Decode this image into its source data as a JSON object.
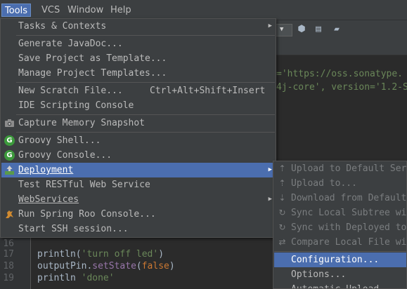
{
  "menubar": {
    "items": [
      {
        "label": "Tools"
      },
      {
        "label": "VCS"
      },
      {
        "label": "Window"
      },
      {
        "label": "Help"
      }
    ]
  },
  "editor": {
    "top_lines": [
      {
        "text_a": "='https://oss.sonatype."
      },
      {
        "text_a": "4j-core', version='1.2-S"
      }
    ],
    "lines": [
      {
        "num": "16",
        "code": ""
      },
      {
        "num": "17",
        "fn": "println",
        "open": "(",
        "str": "'turn off led'",
        "close": ")"
      },
      {
        "num": "18",
        "obj": "outputPin.",
        "fn": "setState",
        "open": "(",
        "kw": "false",
        "close": ")"
      },
      {
        "num": "19",
        "fn": "println",
        "space": " ",
        "str": "'done'"
      }
    ]
  },
  "tools_menu": {
    "items": [
      {
        "label": "Tasks & Contexts",
        "has_submenu": true
      },
      {
        "label": "Generate JavaDoc..."
      },
      {
        "label": "Save Project as Template..."
      },
      {
        "label": "Manage Project Templates..."
      },
      {
        "label": "New Scratch File...",
        "shortcut": "Ctrl+Alt+Shift+Insert"
      },
      {
        "label": "IDE Scripting Console"
      },
      {
        "label": "Capture Memory Snapshot",
        "icon": "memory-snapshot-icon"
      },
      {
        "label": "Groovy Shell...",
        "icon": "groovy-icon",
        "icon_text": "G"
      },
      {
        "label": "Groovy Console...",
        "icon": "groovy-icon",
        "icon_text": "G"
      },
      {
        "label": "Deployment",
        "icon": "deployment-icon",
        "has_submenu": true,
        "selected": true
      },
      {
        "label": "Test RESTful Web Service"
      },
      {
        "label": "WebServices",
        "has_submenu": true
      },
      {
        "label": "Run Spring Roo Console...",
        "icon": "spring-roo-icon"
      },
      {
        "label": "Start SSH session..."
      }
    ]
  },
  "deployment_menu": {
    "items": [
      {
        "label": "Upload to Default Ser",
        "icon": "upload-icon",
        "disabled": true
      },
      {
        "label": "Upload to...",
        "icon": "upload-icon",
        "disabled": true
      },
      {
        "label": "Download from Default",
        "icon": "download-icon",
        "disabled": true
      },
      {
        "label": "Sync Local Subtree wi",
        "icon": "sync-icon",
        "disabled": true
      },
      {
        "label": "Sync with Deployed to",
        "icon": "sync-icon",
        "disabled": true
      },
      {
        "label": "Compare Local File wi",
        "icon": "compare-icon",
        "disabled": true
      },
      {
        "label": "Configuration...",
        "selected": true
      },
      {
        "label": "Options..."
      },
      {
        "label": "Automatic Upload"
      }
    ]
  },
  "colors": {
    "selection": "#4b6eaf",
    "menu_bg": "#3c3f41",
    "editor_bg": "#2b2b2b",
    "string": "#6a8759",
    "keyword": "#cc7832"
  }
}
